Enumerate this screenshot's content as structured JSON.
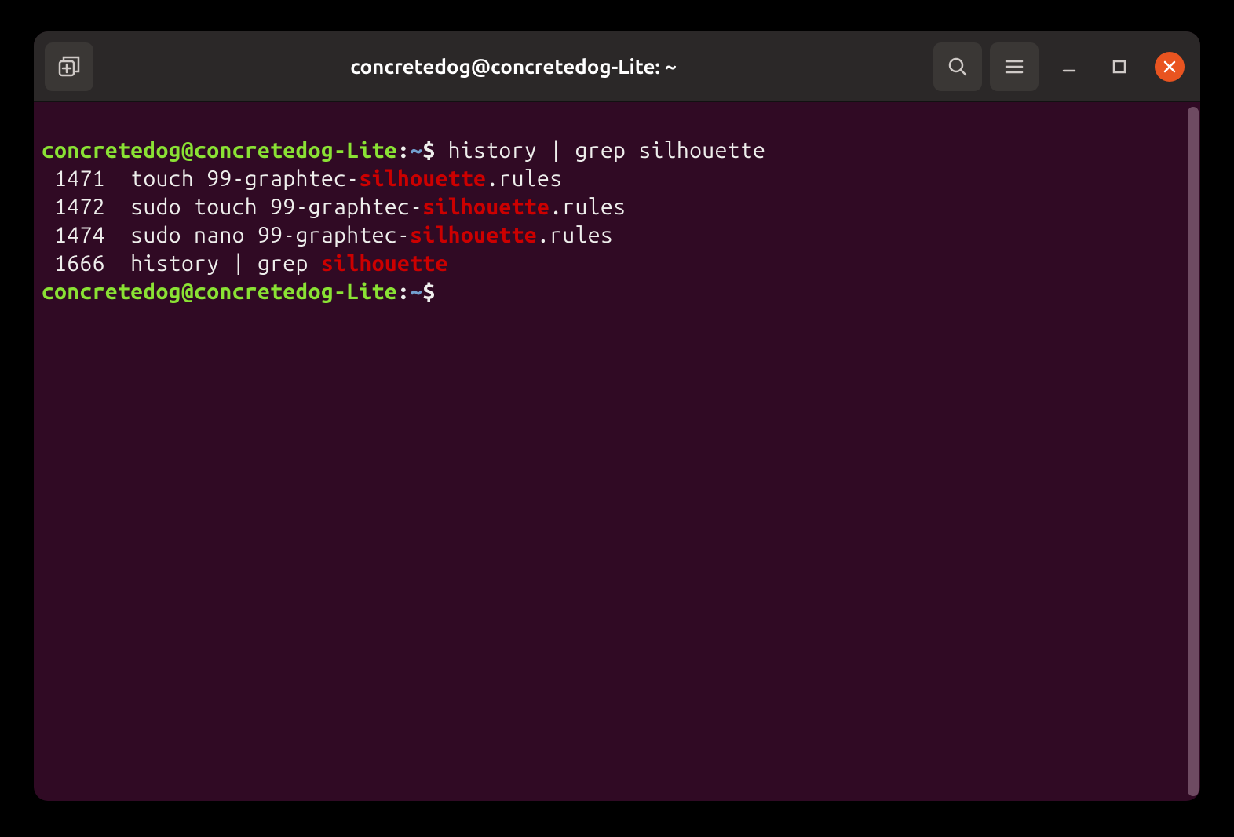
{
  "window": {
    "title": "concretedog@concretedog-Lite: ~"
  },
  "prompt": {
    "user_host": "concretedog@concretedog-Lite",
    "colon": ":",
    "path": "~",
    "symbol": "$"
  },
  "command1": "history | grep silhouette",
  "history": [
    {
      "num": " 1471  ",
      "pre": "touch 99-graphtec-",
      "hl": "silhouette",
      "post": ".rules"
    },
    {
      "num": " 1472  ",
      "pre": "sudo touch 99-graphtec-",
      "hl": "silhouette",
      "post": ".rules"
    },
    {
      "num": " 1474  ",
      "pre": "sudo nano 99-graphtec-",
      "hl": "silhouette",
      "post": ".rules"
    },
    {
      "num": " 1666  ",
      "pre": "history | grep ",
      "hl": "silhouette",
      "post": ""
    }
  ],
  "command2": ""
}
